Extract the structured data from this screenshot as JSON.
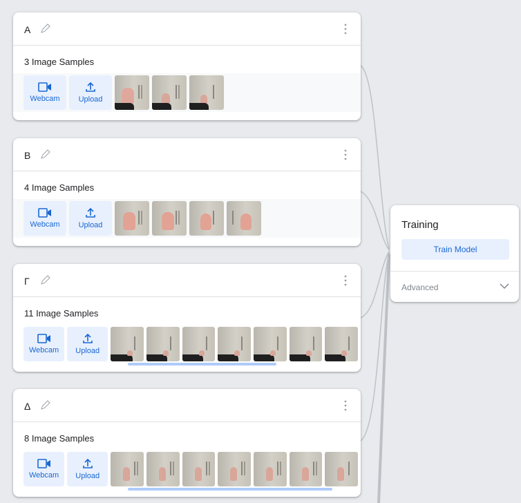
{
  "classes": [
    {
      "name": "Α",
      "samples_label": "3 Image Samples",
      "thumbs": 3
    },
    {
      "name": "Β",
      "samples_label": "4 Image Samples",
      "thumbs": 4
    },
    {
      "name": "Γ",
      "samples_label": "11 Image Samples",
      "thumbs": 7
    },
    {
      "name": "Δ",
      "samples_label": "8 Image Samples",
      "thumbs": 7
    }
  ],
  "actions": {
    "webcam_label": "Webcam",
    "upload_label": "Upload"
  },
  "training": {
    "title": "Training",
    "train_button": "Train Model",
    "advanced_label": "Advanced"
  },
  "colors": {
    "accent": "#1967d2",
    "button_bg": "#e8f0fe",
    "page_bg": "#e8eaed"
  }
}
